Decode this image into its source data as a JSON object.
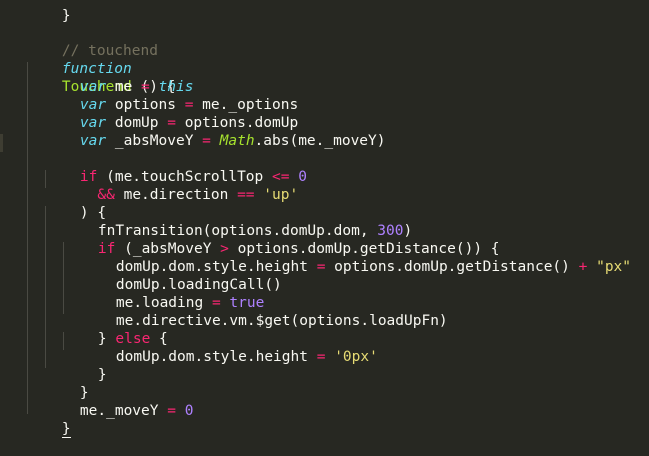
{
  "code": {
    "top_brace": "}",
    "l1_comment": "// touchend",
    "l2_kw": "function",
    "l2_name": "Touchend",
    "l2_rest": " () {",
    "l3_kw": "var",
    "l3_a": " me ",
    "l3_op": "=",
    "l3_b": " ",
    "l3_this": "this",
    "l4_kw": "var",
    "l4_a": " options ",
    "l4_op": "=",
    "l4_b": " me._options",
    "l5_kw": "var",
    "l5_a": " domUp ",
    "l5_op": "=",
    "l5_b": " options.domUp",
    "l6_kw": "var",
    "l6_a": " _absMoveY ",
    "l6_op": "=",
    "l6_math": "Math",
    "l6_b": ".abs(me._moveY)",
    "l8_if": "if",
    "l8_a": " (me.touchScrollTop ",
    "l8_op": "<=",
    "l8_num": "0",
    "l9_op": "&&",
    "l9_a": " me.direction ",
    "l9_op2": "==",
    "l9_str": "'up'",
    "l10": ") {",
    "l11_a": "fnTransition(options.domUp.dom, ",
    "l11_num": "300",
    "l11_b": ")",
    "l12_if": "if",
    "l12_a": " (_absMoveY ",
    "l12_op": ">",
    "l12_b": " options.domUp.getDistance()) {",
    "l13_a": "domUp.dom.style.height ",
    "l13_op": "=",
    "l13_b": " options.domUp.getDistance() ",
    "l13_op2": "+",
    "l13_str": "\"px\"",
    "l14": "domUp.loadingCall()",
    "l15_a": "me.loading ",
    "l15_op": "=",
    "l15_true": "true",
    "l16": "me.directive.vm.$get(options.loadUpFn)",
    "l17_a": "} ",
    "l17_else": "else",
    "l17_b": " {",
    "l18_a": "domUp.dom.style.height ",
    "l18_op": "=",
    "l18_str": "'0px'",
    "l19": "}",
    "l20": "}",
    "l21_a": "me._moveY ",
    "l21_op": "=",
    "l21_num": "0",
    "l22": "}"
  },
  "colors": {
    "background": "#272822",
    "comment": "#75715e",
    "keyword": "#66d9ef",
    "function_name": "#a6e22e",
    "operator": "#f92672",
    "number": "#ae81ff",
    "string": "#e6db74",
    "text": "#f8f8f2"
  }
}
